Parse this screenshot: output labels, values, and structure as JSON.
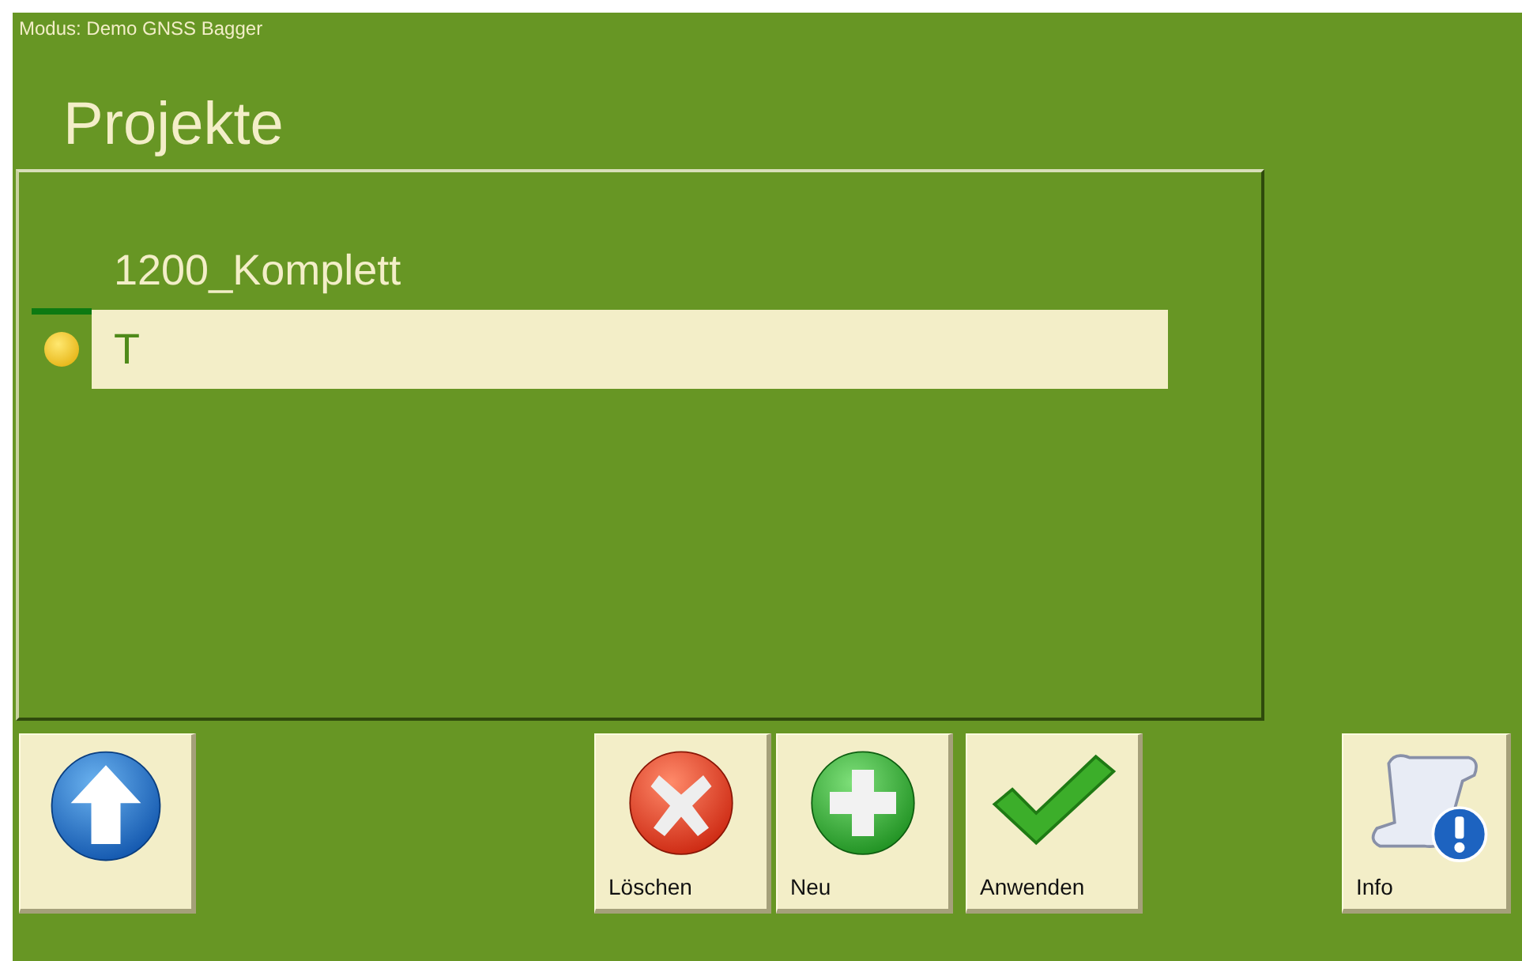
{
  "mode": "Modus: Demo GNSS Bagger",
  "title": "Projekte",
  "projects": [
    {
      "label": "1200_Komplett",
      "selected": false
    },
    {
      "label": "T",
      "selected": true
    }
  ],
  "buttons": [
    {
      "kind": "up"
    },
    {
      "kind": "delete",
      "label": "Löschen"
    },
    {
      "kind": "new",
      "label": "Neu"
    },
    {
      "kind": "apply",
      "label": "Anwenden"
    },
    {
      "kind": "info",
      "label": "Info"
    }
  ]
}
